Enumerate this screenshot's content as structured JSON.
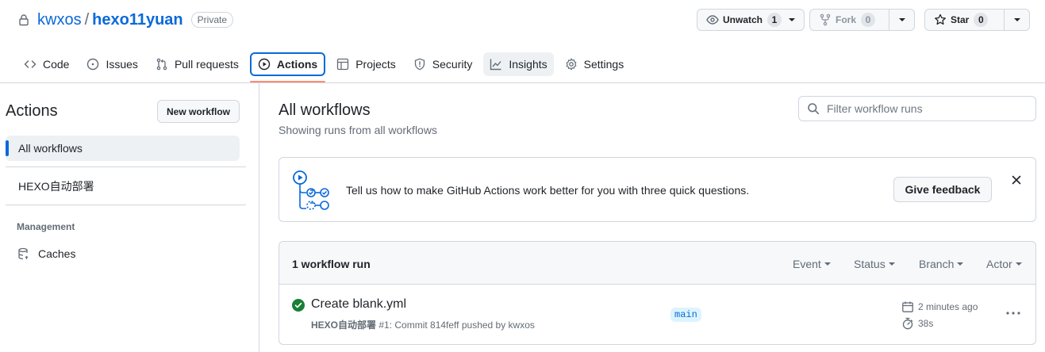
{
  "repo": {
    "owner": "kwxos",
    "separator": "/",
    "name": "hexo11yuan",
    "visibility": "Private"
  },
  "header_actions": {
    "watch": {
      "label": "Unwatch",
      "count": "1"
    },
    "fork": {
      "label": "Fork",
      "count": "0"
    },
    "star": {
      "label": "Star",
      "count": "0"
    }
  },
  "tabs": [
    {
      "label": "Code",
      "icon": "code-icon"
    },
    {
      "label": "Issues",
      "icon": "issue-icon"
    },
    {
      "label": "Pull requests",
      "icon": "pull-request-icon"
    },
    {
      "label": "Actions",
      "icon": "play-icon",
      "selected": true
    },
    {
      "label": "Projects",
      "icon": "table-icon"
    },
    {
      "label": "Security",
      "icon": "shield-icon"
    },
    {
      "label": "Insights",
      "icon": "graph-icon"
    },
    {
      "label": "Settings",
      "icon": "gear-icon"
    }
  ],
  "sidebar": {
    "title": "Actions",
    "new_workflow": "New workflow",
    "items": [
      {
        "label": "All workflows",
        "active": true
      },
      {
        "label": "HEXO自动部署"
      }
    ],
    "section": "Management",
    "caches": "Caches"
  },
  "main": {
    "title": "All workflows",
    "subtitle": "Showing runs from all workflows",
    "filter_placeholder": "Filter workflow runs"
  },
  "feedback": {
    "message": "Tell us how to make GitHub Actions work better for you with three quick questions.",
    "button": "Give feedback"
  },
  "runs": {
    "count_label": "1 workflow run",
    "filters": [
      "Event",
      "Status",
      "Branch",
      "Actor"
    ],
    "items": [
      {
        "title": "Create blank.yml",
        "workflow": "HEXO自动部署",
        "meta": " #1: Commit 814feff pushed by kwxos",
        "branch": "main",
        "time": "2 minutes ago",
        "duration": "38s",
        "status": "success"
      }
    ]
  },
  "colors": {
    "accent": "#0969da",
    "success": "#1a7f37",
    "tab_underline": "#fd8c73",
    "border": "#d0d7de"
  }
}
